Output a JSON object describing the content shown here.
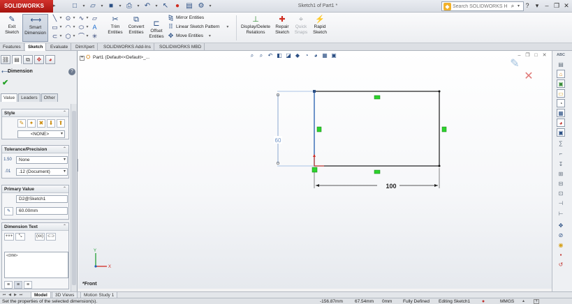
{
  "titlebar": {
    "app_logo": "SOLIDWORKS",
    "document_title": "Sketch1 of Part1 *",
    "help_search_placeholder": "Search SOLIDWORKS Help",
    "quick_icons": [
      "new-document-icon",
      "open-icon",
      "save-icon",
      "print-icon",
      "undo-icon",
      "select-icon",
      "rebuild-icon",
      "file-properties-icon",
      "options-icon"
    ]
  },
  "ribbon": {
    "exit_sketch": "Exit\nSketch",
    "smart_dimension": "Smart\nDimension",
    "trim_entities": "Trim\nEntities",
    "convert_entities": "Convert\nEntities",
    "offset_entities": "Offset\nEntities",
    "mirror_entities": "Mirror Entities",
    "linear_sketch_pattern": "Linear Sketch Pattern",
    "move_entities": "Move Entities",
    "display_delete_relations": "Display/Delete\nRelations",
    "repair_sketch": "Repair\nSketch",
    "quick_snaps": "Quick\nSnaps",
    "rapid_sketch": "Rapid\nSketch"
  },
  "command_tabs": [
    "Features",
    "Sketch",
    "Evaluate",
    "DimXpert",
    "SOLIDWORKS Add-Ins",
    "SOLIDWORKS MBD"
  ],
  "feature_tree": {
    "root": "Part1  (Default<<Default>_..."
  },
  "property_manager": {
    "title": "Dimension",
    "tabs": [
      "Value",
      "Leaders",
      "Other"
    ],
    "style": {
      "header": "Style",
      "selected": "<NONE>"
    },
    "tolerance": {
      "header": "Tolerance/Precision",
      "tolerance_type": "None",
      "precision": ".12 (Document)"
    },
    "primary_value": {
      "header": "Primary Value",
      "name": "D2@Sketch1",
      "value": "60.00mm"
    },
    "dimension_text": {
      "header": "Dimension Text",
      "text": "<DIM>",
      "paren_button": "(xx)"
    }
  },
  "sketch": {
    "vertical_dimension": "60",
    "horizontal_dimension": "100",
    "axis_x": "X",
    "axis_y": "Y",
    "view_label": "*Front"
  },
  "model_tabs": [
    "Model",
    "3D Views",
    "Motion Study 1"
  ],
  "status": {
    "message": "Set the properties of the selected dimension(s).",
    "x_coord": "-156.87mm",
    "y_coord": "67.54mm",
    "z_coord": "0mm",
    "definition": "Fully Defined",
    "editing": "Editing Sketch1",
    "units": "MMGS"
  },
  "colors": {
    "logo_red": "#c0271f",
    "dimension_blue": "#6f93c6",
    "selection_blue": "#2f6fc6",
    "relation_green": "#2dd32d",
    "accept_green": "#21a024"
  }
}
